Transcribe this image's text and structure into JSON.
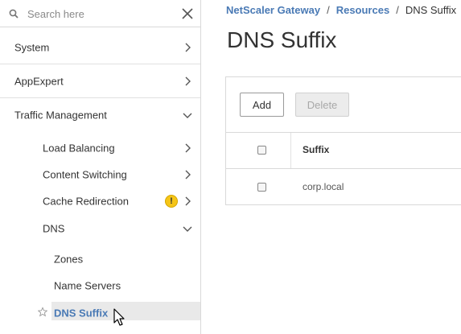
{
  "sidebar": {
    "search_placeholder": "Search here",
    "items": {
      "system": "System",
      "appexpert": "AppExpert",
      "traffic_management": "Traffic Management",
      "load_balancing": "Load Balancing",
      "content_switching": "Content Switching",
      "cache_redirection": "Cache Redirection",
      "dns": "DNS",
      "zones": "Zones",
      "name_servers": "Name Servers",
      "dns_suffix": "DNS Suffix"
    },
    "warning_glyph": "!"
  },
  "breadcrumb": {
    "item1": "NetScaler Gateway",
    "item2": "Resources",
    "current": "DNS Suffix",
    "separator": "/"
  },
  "page": {
    "title": "DNS Suffix"
  },
  "toolbar": {
    "add_label": "Add",
    "delete_label": "Delete"
  },
  "table": {
    "header_suffix": "Suffix",
    "rows": [
      {
        "suffix": "corp.local"
      }
    ]
  },
  "colors": {
    "accent_link": "#4a7ab5",
    "warning": "#f5c518",
    "selected_bg": "#e9e9e9"
  },
  "icons": [
    "search-icon",
    "close-icon",
    "chevron-right-icon",
    "chevron-down-icon",
    "warning-icon",
    "star-icon",
    "mouse-cursor-icon"
  ]
}
